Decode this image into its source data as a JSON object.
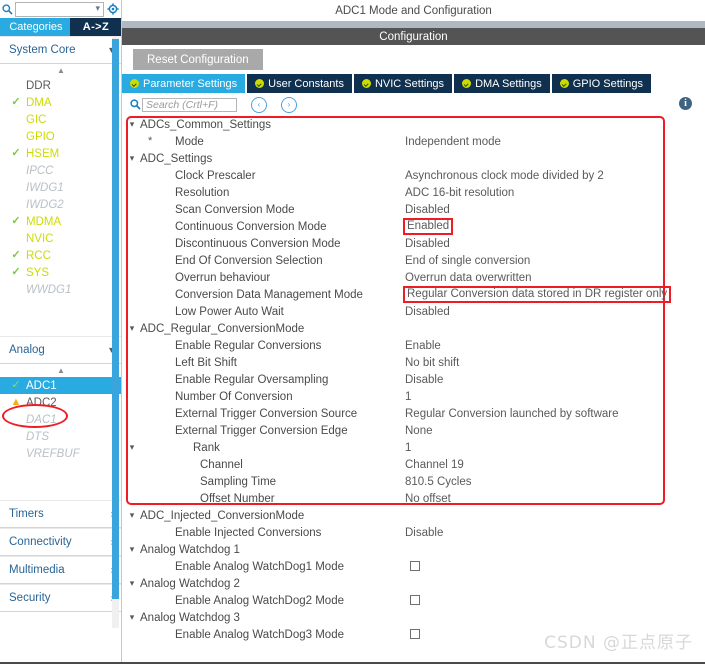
{
  "sidebar": {
    "search": {
      "value": "",
      "placeholder": "",
      "icon": "search-icon"
    },
    "gear_icon": "gear-icon",
    "tabs": [
      {
        "label": "Categories",
        "active": true
      },
      {
        "label": "A->Z",
        "active": false
      }
    ],
    "groups": [
      {
        "label": "System Core",
        "expanded": true,
        "items": [
          {
            "label": "DDR",
            "state": "dark"
          },
          {
            "label": "DMA",
            "state": "ok"
          },
          {
            "label": "GIC",
            "state": "plain"
          },
          {
            "label": "GPIO",
            "state": "plain"
          },
          {
            "label": "HSEM",
            "state": "ok"
          },
          {
            "label": "IPCC",
            "state": "grey"
          },
          {
            "label": "IWDG1",
            "state": "grey"
          },
          {
            "label": "IWDG2",
            "state": "grey"
          },
          {
            "label": "MDMA",
            "state": "ok"
          },
          {
            "label": "NVIC",
            "state": "plain"
          },
          {
            "label": "RCC",
            "state": "ok"
          },
          {
            "label": "SYS",
            "state": "ok"
          },
          {
            "label": "WWDG1",
            "state": "grey"
          }
        ]
      },
      {
        "label": "Analog",
        "expanded": true,
        "items": [
          {
            "label": "ADC1",
            "state": "selected"
          },
          {
            "label": "ADC2",
            "state": "warn"
          },
          {
            "label": "DAC1",
            "state": "grey"
          },
          {
            "label": "DTS",
            "state": "grey"
          },
          {
            "label": "VREFBUF",
            "state": "grey"
          }
        ]
      },
      {
        "label": "Timers",
        "expanded": false,
        "items": []
      },
      {
        "label": "Connectivity",
        "expanded": false,
        "items": []
      },
      {
        "label": "Multimedia",
        "expanded": false,
        "items": []
      },
      {
        "label": "Security",
        "expanded": false,
        "items": []
      }
    ]
  },
  "main": {
    "title": "ADC1 Mode and Configuration",
    "config_header": "Configuration",
    "reset_button": "Reset Configuration",
    "tabs": [
      {
        "label": "Parameter Settings",
        "active": true
      },
      {
        "label": "User Constants",
        "active": false
      },
      {
        "label": "NVIC Settings",
        "active": false
      },
      {
        "label": "DMA Settings",
        "active": false
      },
      {
        "label": "GPIO Settings",
        "active": false
      }
    ],
    "search": {
      "value": "",
      "placeholder": "Search (Crtl+F)"
    },
    "nav_prev": "‹",
    "nav_next": "›",
    "info_icon": "info-icon",
    "rows": [
      {
        "type": "group",
        "indent": 0,
        "chev": true,
        "key": "ADCs_Common_Settings"
      },
      {
        "type": "star",
        "indent": 42,
        "star": true,
        "key": "Mode",
        "value": "Independent mode"
      },
      {
        "type": "group",
        "indent": 0,
        "chev": true,
        "key": "ADC_Settings"
      },
      {
        "type": "param",
        "indent": 53,
        "key": "Clock Prescaler",
        "value": "Asynchronous clock mode divided by 2"
      },
      {
        "type": "param",
        "indent": 53,
        "key": "Resolution",
        "value": "ADC 16-bit resolution"
      },
      {
        "type": "param",
        "indent": 53,
        "key": "Scan Conversion Mode",
        "value": "Disabled"
      },
      {
        "type": "param",
        "indent": 53,
        "key": "Continuous Conversion Mode",
        "value": "Enabled",
        "highlight": true
      },
      {
        "type": "param",
        "indent": 53,
        "key": "Discontinuous Conversion Mode",
        "value": "Disabled"
      },
      {
        "type": "param",
        "indent": 53,
        "key": "End Of Conversion Selection",
        "value": "End of single conversion"
      },
      {
        "type": "param",
        "indent": 53,
        "key": "Overrun behaviour",
        "value": "Overrun data overwritten"
      },
      {
        "type": "param",
        "indent": 53,
        "key": "Conversion Data Management Mode",
        "value": "Regular Conversion data stored in DR register only",
        "highlight": true
      },
      {
        "type": "param",
        "indent": 53,
        "key": "Low Power Auto Wait",
        "value": "Disabled"
      },
      {
        "type": "group",
        "indent": 0,
        "chev": true,
        "key": "ADC_Regular_ConversionMode"
      },
      {
        "type": "param",
        "indent": 53,
        "key": "Enable Regular Conversions",
        "value": "Enable"
      },
      {
        "type": "param",
        "indent": 53,
        "key": "Left Bit Shift",
        "value": "No bit shift"
      },
      {
        "type": "param",
        "indent": 53,
        "key": "Enable Regular Oversampling",
        "value": "Disable"
      },
      {
        "type": "param",
        "indent": 53,
        "key": "Number Of Conversion",
        "value": "1"
      },
      {
        "type": "param",
        "indent": 53,
        "key": "External Trigger Conversion Source",
        "value": "Regular Conversion launched by software"
      },
      {
        "type": "param",
        "indent": 53,
        "key": "External Trigger Conversion Edge",
        "value": "None"
      },
      {
        "type": "group2",
        "indent": 71,
        "chev": true,
        "key": "Rank",
        "value": "1"
      },
      {
        "type": "param",
        "indent": 78,
        "key": "Channel",
        "value": "Channel 19"
      },
      {
        "type": "param",
        "indent": 78,
        "key": "Sampling Time",
        "value": "810.5 Cycles"
      },
      {
        "type": "param",
        "indent": 78,
        "key": "Offset Number",
        "value": "No offset"
      },
      {
        "type": "group",
        "indent": 0,
        "chev": true,
        "key": "ADC_Injected_ConversionMode"
      },
      {
        "type": "param",
        "indent": 53,
        "key": "Enable Injected Conversions",
        "value": "Disable"
      },
      {
        "type": "group",
        "indent": 0,
        "chev": true,
        "key": "Analog Watchdog 1"
      },
      {
        "type": "check",
        "indent": 53,
        "key": "Enable Analog WatchDog1 Mode",
        "checked": false
      },
      {
        "type": "group",
        "indent": 0,
        "chev": true,
        "key": "Analog Watchdog 2"
      },
      {
        "type": "check",
        "indent": 53,
        "key": "Enable Analog WatchDog2 Mode",
        "checked": false
      },
      {
        "type": "group",
        "indent": 0,
        "chev": true,
        "key": "Analog Watchdog 3"
      },
      {
        "type": "check",
        "indent": 53,
        "key": "Enable Analog WatchDog3 Mode",
        "checked": false
      }
    ]
  },
  "watermark": "CSDN @正点原子",
  "colors": {
    "accent_blue": "#29abe2",
    "tab_dark": "#10304f",
    "highlight_red": "#ee1c24",
    "label_green": "#cddc00",
    "header_grey": "#545454"
  }
}
